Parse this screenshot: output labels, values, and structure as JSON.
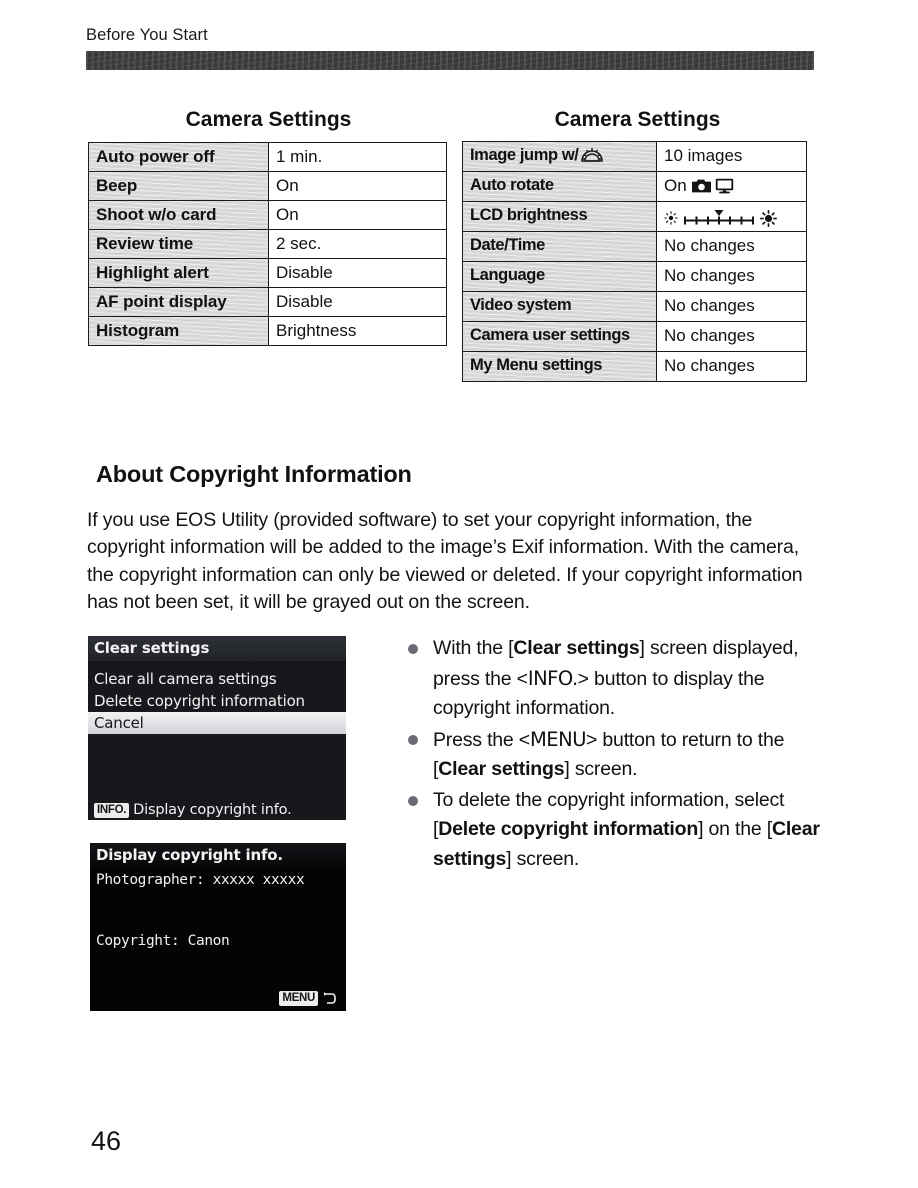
{
  "page": {
    "running_header": "Before You Start",
    "folio": "46"
  },
  "tables": {
    "left": {
      "title": "Camera Settings",
      "rows": [
        {
          "setting": "Auto power off",
          "value": "1 min."
        },
        {
          "setting": "Beep",
          "value": "On"
        },
        {
          "setting": "Shoot w/o card",
          "value": "On"
        },
        {
          "setting": "Review time",
          "value": "2 sec."
        },
        {
          "setting": "Highlight alert",
          "value": "Disable"
        },
        {
          "setting": "AF point display",
          "value": "Disable"
        },
        {
          "setting": "Histogram",
          "value": "Brightness"
        }
      ]
    },
    "right": {
      "title": "Camera Settings",
      "rows": [
        {
          "setting": "Image jump w/",
          "setting_icon": "main-dial-icon",
          "value": "10 images"
        },
        {
          "setting": "Auto rotate",
          "value": "On",
          "value_icons": [
            "camera-icon",
            "monitor-icon"
          ]
        },
        {
          "setting": "LCD brightness",
          "value": "",
          "value_icons": [
            "dim-sun-icon",
            "brightness-scale-icon",
            "bright-sun-icon"
          ]
        },
        {
          "setting": "Date/Time",
          "value": "No changes"
        },
        {
          "setting": "Language",
          "value": "No changes"
        },
        {
          "setting": "Video system",
          "value": "No changes"
        },
        {
          "setting": "Camera user settings",
          "value": "No changes"
        },
        {
          "setting": "My Menu settings",
          "value": "No changes"
        }
      ]
    }
  },
  "section": {
    "heading": "About Copyright Information",
    "paragraph": "If you use EOS Utility (provided software) to set your copyright information, the copyright information will be added to the image’s Exif information. With the camera, the copyright information can only be viewed or deleted. If your copyright information has not been set, it will be grayed out on the screen."
  },
  "lcd_clear_settings": {
    "title": "Clear settings",
    "items": [
      {
        "label": "Clear all camera settings",
        "selected": false
      },
      {
        "label": "Delete copyright information",
        "selected": false
      },
      {
        "label": "Cancel",
        "selected": true
      }
    ],
    "footer_badge": "INFO.",
    "footer_text": "Display copyright info."
  },
  "lcd_copyright_info": {
    "title": "Display copyright info.",
    "photographer_label": "Photographer:",
    "photographer_value": "xxxxx xxxxx",
    "copyright_label": "Copyright:",
    "copyright_value": "Canon",
    "footer_badge": "MENU",
    "footer_icon": "return-arrow-icon"
  },
  "bullets": [
    {
      "segments": [
        {
          "t": "With the [",
          "b": false
        },
        {
          "t": "Clear settings",
          "b": true
        },
        {
          "t": "] screen displayed, press the <",
          "b": false
        },
        {
          "t": "INFO.",
          "b": false,
          "face": true
        },
        {
          "t": "> button to display the copyright information.",
          "b": false
        }
      ]
    },
    {
      "segments": [
        {
          "t": "Press the <",
          "b": false
        },
        {
          "t": "MENU",
          "b": false,
          "face": true
        },
        {
          "t": "> button to return to the [",
          "b": false
        },
        {
          "t": "Clear settings",
          "b": true
        },
        {
          "t": "] screen.",
          "b": false
        }
      ]
    },
    {
      "segments": [
        {
          "t": "To delete the copyright information, select [",
          "b": false
        },
        {
          "t": "Delete copyright information",
          "b": true
        },
        {
          "t": "] on the [",
          "b": false
        },
        {
          "t": "Clear settings",
          "b": true
        },
        {
          "t": "] screen.",
          "b": false
        }
      ]
    }
  ],
  "colors": {
    "page_background": "#ffffff",
    "text": "#111111",
    "rule_bar": "#3a3a3a",
    "table_key_cell": "#d9d9d9",
    "lcd_background": "#000000",
    "lcd_highlight": "#e9e9ec",
    "bullet_dot": "#6b6b78"
  }
}
